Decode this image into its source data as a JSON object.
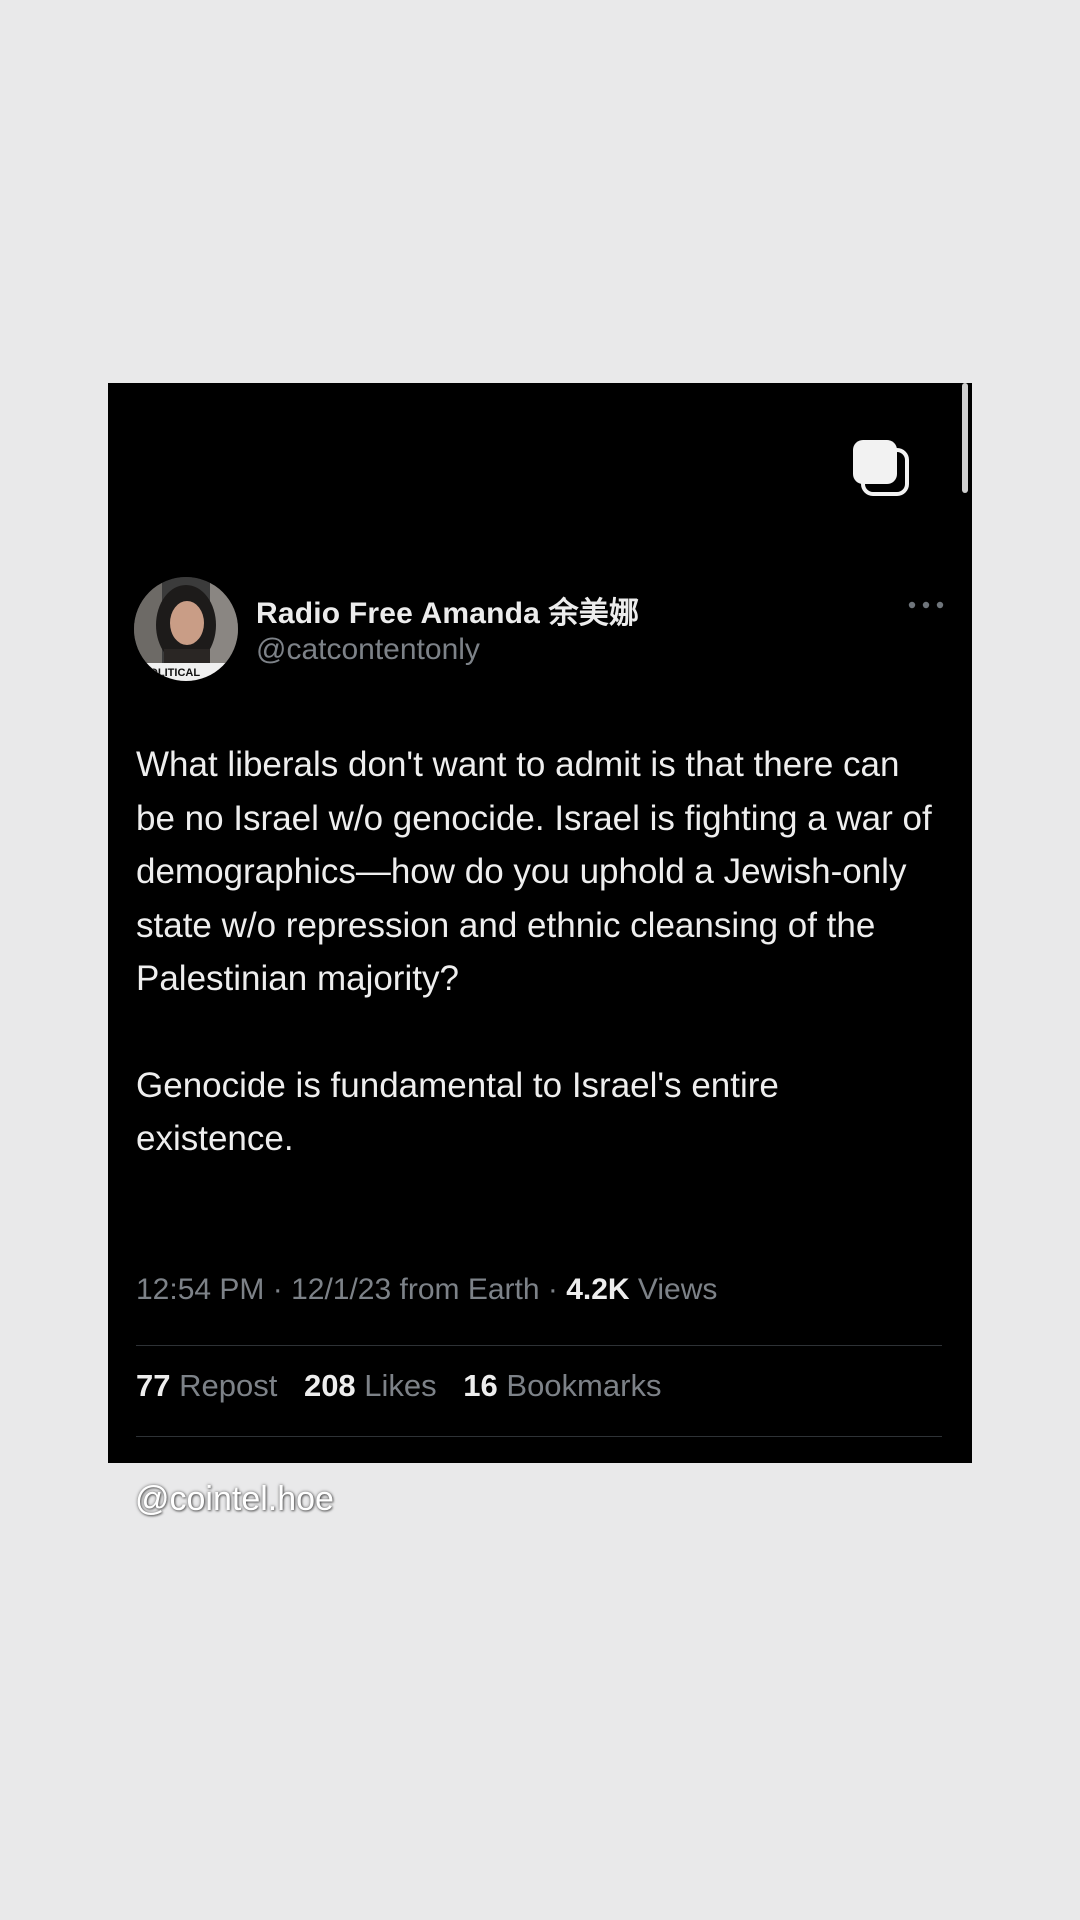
{
  "tweet": {
    "display_name": "Radio Free Amanda 余美娜",
    "handle": "@catcontentonly",
    "avatar_caption": "POLITICAL",
    "paragraphs": [
      "What liberals don't want to admit is that there can be no Israel w/o genocide. Israel is fighting a war of demographics—how do you uphold a Jewish-only state w/o repression and ethnic cleansing of the Palestinian majority?",
      "Genocide is fundamental to Israel's entire existence."
    ],
    "meta": {
      "time_date": "12:54 PM · 12/1/23 from Earth · ",
      "views_count": "4.2K",
      "views_label": " Views"
    },
    "stats": {
      "reposts_count": "77",
      "reposts_label": " Repost",
      "likes_count": "208",
      "likes_label": " Likes",
      "bookmarks_count": "16",
      "bookmarks_label": " Bookmarks"
    }
  },
  "overlay": {
    "watermark": "@cointel.hoe"
  },
  "colors": {
    "background": "#e9e9ea",
    "card": "#000000",
    "primary_text": "#eeeeee",
    "secondary_text": "#7d8288"
  },
  "icons": {
    "copy": "copy-icon",
    "more": "more-icon"
  }
}
